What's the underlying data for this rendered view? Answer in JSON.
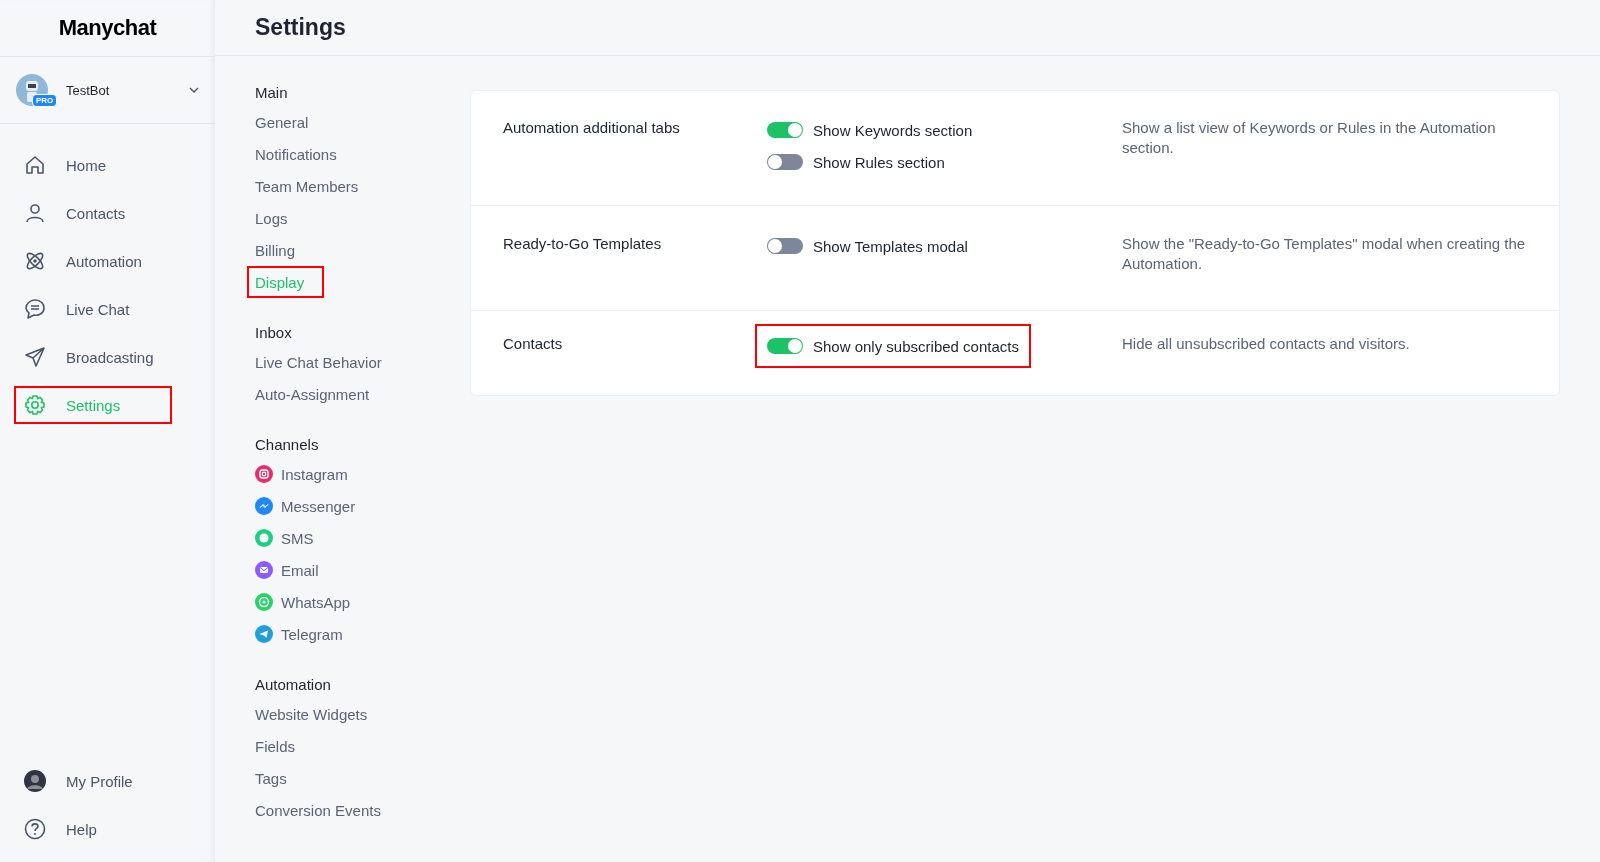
{
  "logo": "Manychat",
  "account": {
    "name": "TestBot",
    "badge": "PRO"
  },
  "nav": [
    {
      "label": "Home",
      "kind": "home",
      "selected": false,
      "highlighted": false
    },
    {
      "label": "Contacts",
      "kind": "person",
      "selected": false,
      "highlighted": false
    },
    {
      "label": "Automation",
      "kind": "atom",
      "selected": false,
      "highlighted": false
    },
    {
      "label": "Live Chat",
      "kind": "chat",
      "selected": false,
      "highlighted": false
    },
    {
      "label": "Broadcasting",
      "kind": "send",
      "selected": false,
      "highlighted": false
    },
    {
      "label": "Settings",
      "kind": "gear",
      "selected": true,
      "highlighted": true
    }
  ],
  "nav_bottom": [
    {
      "label": "My Profile",
      "kind": "avatar"
    },
    {
      "label": "Help",
      "kind": "help"
    }
  ],
  "page_title": "Settings",
  "subnav": [
    {
      "heading": "Main",
      "items": [
        {
          "label": "General",
          "selected": false,
          "highlighted": false
        },
        {
          "label": "Notifications",
          "selected": false,
          "highlighted": false
        },
        {
          "label": "Team Members",
          "selected": false,
          "highlighted": false
        },
        {
          "label": "Logs",
          "selected": false,
          "highlighted": false
        },
        {
          "label": "Billing",
          "selected": false,
          "highlighted": false
        },
        {
          "label": "Display",
          "selected": true,
          "highlighted": true
        }
      ]
    },
    {
      "heading": "Inbox",
      "items": [
        {
          "label": "Live Chat Behavior",
          "selected": false,
          "highlighted": false
        },
        {
          "label": "Auto-Assignment",
          "selected": false,
          "highlighted": false
        }
      ]
    },
    {
      "heading": "Channels",
      "items": [
        {
          "label": "Instagram",
          "selected": false,
          "highlighted": false,
          "kind": "camera",
          "color": "#e1306c"
        },
        {
          "label": "Messenger",
          "selected": false,
          "highlighted": false,
          "kind": "bolt",
          "color": "#1e88f5"
        },
        {
          "label": "SMS",
          "selected": false,
          "highlighted": false,
          "kind": "bubble",
          "color": "#1fcf85"
        },
        {
          "label": "Email",
          "selected": false,
          "highlighted": false,
          "kind": "envelope",
          "color": "#8b5cf6"
        },
        {
          "label": "WhatsApp",
          "selected": false,
          "highlighted": false,
          "kind": "phone",
          "color": "#25d366"
        },
        {
          "label": "Telegram",
          "selected": false,
          "highlighted": false,
          "kind": "plane",
          "color": "#229ed9"
        }
      ]
    },
    {
      "heading": "Automation",
      "items": [
        {
          "label": "Website Widgets",
          "selected": false,
          "highlighted": false
        },
        {
          "label": "Fields",
          "selected": false,
          "highlighted": false
        },
        {
          "label": "Tags",
          "selected": false,
          "highlighted": false
        },
        {
          "label": "Conversion Events",
          "selected": false,
          "highlighted": false
        }
      ]
    }
  ],
  "settings": [
    {
      "title": "Automation additional tabs",
      "toggles": [
        {
          "label": "Show Keywords section",
          "on": true,
          "highlighted": false
        },
        {
          "label": "Show Rules section",
          "on": false,
          "highlighted": false
        }
      ],
      "description": "Show a list view of Keywords or Rules in the Automation section."
    },
    {
      "title": "Ready-to-Go Templates",
      "toggles": [
        {
          "label": "Show Templates modal",
          "on": false,
          "highlighted": false
        }
      ],
      "description": "Show the \"Ready-to-Go Templates\" modal when creating the Automation."
    },
    {
      "title": "Contacts",
      "toggles": [
        {
          "label": "Show only subscribed contacts",
          "on": true,
          "highlighted": true
        }
      ],
      "description": "Hide all unsubscribed contacts and visitors."
    }
  ]
}
